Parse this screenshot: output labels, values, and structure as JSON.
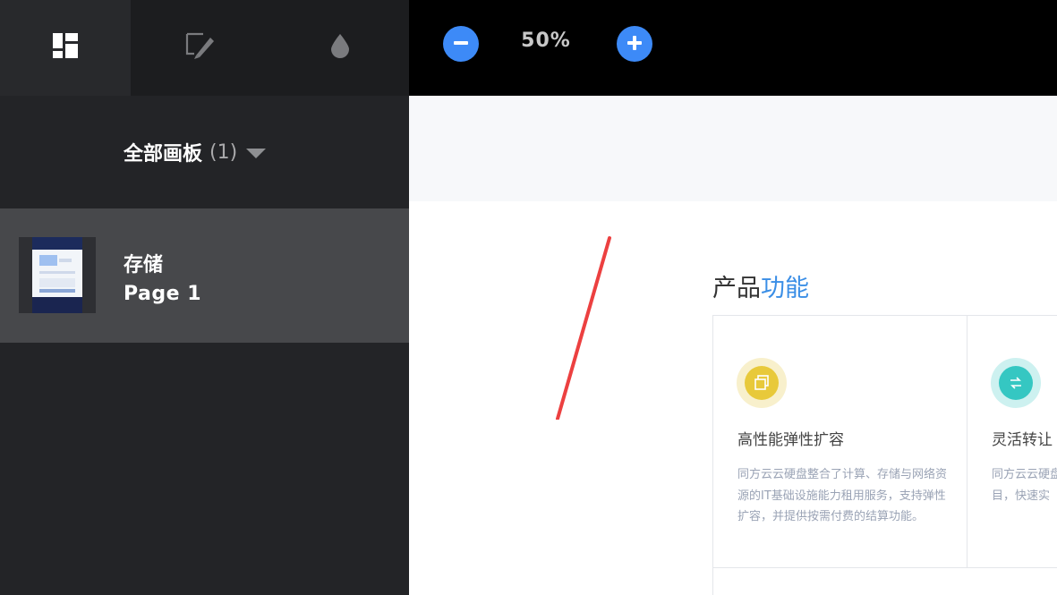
{
  "toolbar": {
    "tabs": [
      {
        "icon": "dashboard-icon",
        "active": true
      },
      {
        "icon": "edit-annotate-icon",
        "active": false
      },
      {
        "icon": "color-drop-icon",
        "active": false
      }
    ],
    "zoom_level": "50%",
    "accent_color": "#3d8af7"
  },
  "sidebar": {
    "board_title": "全部画板",
    "board_count": "(1)",
    "pages": [
      {
        "name": "存储",
        "subtitle": "Page 1",
        "selected": true
      }
    ]
  },
  "canvas": {
    "section_title_dark": "产品",
    "section_title_accent": "功能",
    "accent_color": "#3a8ee6",
    "cards": [
      {
        "icon": "stack-copy-icon",
        "title": "高性能弹性扩容",
        "description": "同方云云硬盘整合了计算、存储与网络资源的IT基础设施能力租用服务，支持弹性扩容，并提供按需付费的结算功能。"
      },
      {
        "icon": "transfer-icon",
        "title": "灵活转让",
        "description_lines": [
          "同方云云硬盘",
          "目，快速实"
        ]
      }
    ]
  }
}
